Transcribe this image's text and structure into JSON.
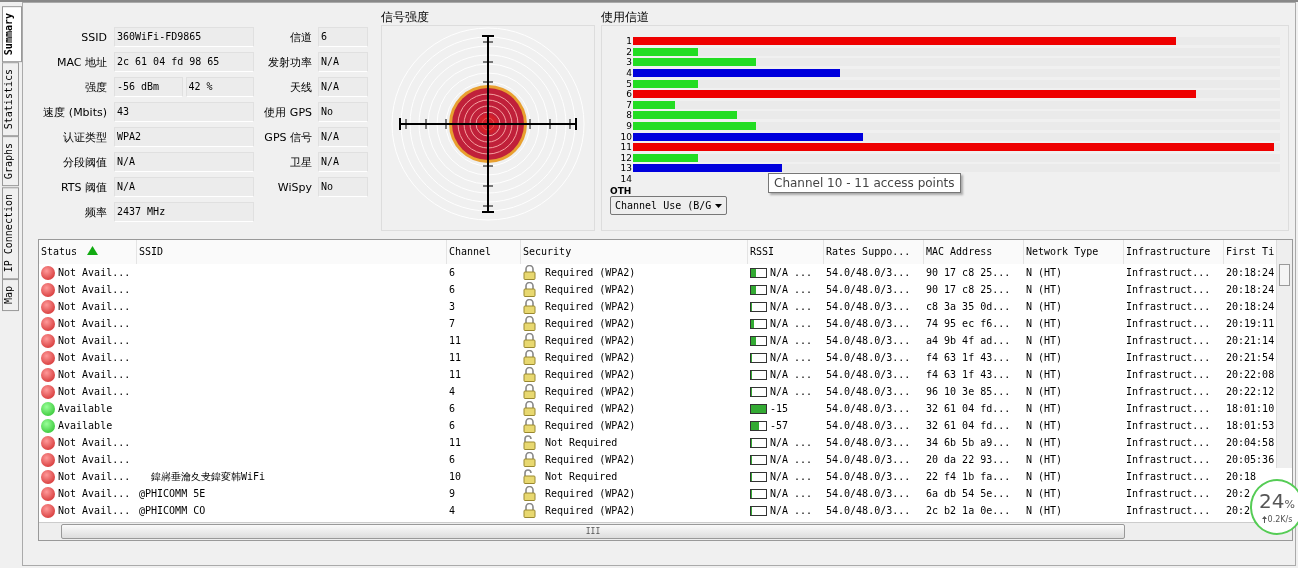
{
  "side_tabs": [
    {
      "label": "Summary",
      "selected": true
    },
    {
      "label": "Statistics",
      "selected": false
    },
    {
      "label": "Graphs",
      "selected": false
    },
    {
      "label": "IP Connection",
      "selected": false
    },
    {
      "label": "Map",
      "selected": false
    }
  ],
  "summary": {
    "left": [
      {
        "label": "SSID",
        "values": [
          "360WiFi-FD9865"
        ]
      },
      {
        "label": "MAC 地址",
        "values": [
          "2c 61 04 fd 98 65"
        ]
      },
      {
        "label": "强度",
        "values": [
          "-56 dBm",
          "42 %"
        ]
      },
      {
        "label": "速度 (Mbits)",
        "values": [
          "43"
        ]
      },
      {
        "label": "认证类型",
        "values": [
          "WPA2"
        ]
      },
      {
        "label": "分段阈值",
        "values": [
          "N/A"
        ]
      },
      {
        "label": "RTS 阈值",
        "values": [
          "N/A"
        ]
      },
      {
        "label": "频率",
        "values": [
          "2437 MHz"
        ]
      }
    ],
    "right": [
      {
        "label": "信道",
        "value": "6"
      },
      {
        "label": "发射功率",
        "value": "N/A"
      },
      {
        "label": "天线",
        "value": "N/A"
      },
      {
        "label": "使用 GPS",
        "value": "No"
      },
      {
        "label": "GPS 信号",
        "value": "N/A"
      },
      {
        "label": "卫星",
        "value": "N/A"
      },
      {
        "label": "WiSpy",
        "value": "No"
      }
    ]
  },
  "signal_panel": {
    "title": "信号强度"
  },
  "channel_panel": {
    "title": "使用信道",
    "channels": [
      {
        "label": "1",
        "level": 0.84,
        "color": "#ee0000"
      },
      {
        "label": "2",
        "level": 0.1,
        "color": "#22dd22"
      },
      {
        "label": "3",
        "level": 0.19,
        "color": "#22dd22"
      },
      {
        "label": "4",
        "level": 0.32,
        "color": "#0000dd"
      },
      {
        "label": "5",
        "level": 0.1,
        "color": "#22dd22"
      },
      {
        "label": "6",
        "level": 0.87,
        "color": "#ee0000"
      },
      {
        "label": "7",
        "level": 0.065,
        "color": "#22dd22"
      },
      {
        "label": "8",
        "level": 0.16,
        "color": "#22dd22"
      },
      {
        "label": "9",
        "level": 0.19,
        "color": "#22dd22"
      },
      {
        "label": "10",
        "level": 0.355,
        "color": "#0000dd"
      },
      {
        "label": "11",
        "level": 0.99,
        "color": "#ee0000"
      },
      {
        "label": "12",
        "level": 0.1,
        "color": "#22dd22"
      },
      {
        "label": "13",
        "level": 0.23,
        "color": "#0000dd"
      },
      {
        "label": "14"
      }
    ],
    "other_label": "OTH",
    "dropdown": "Channel Use (B/G",
    "tooltip": "Channel 10 - 11 access points"
  },
  "table": {
    "columns": [
      "Status",
      "SSID",
      "Channel",
      "Security",
      "RSSI",
      "Rates Suppo...",
      "MAC Address",
      "Network Type",
      "Infrastructure",
      "First Ti"
    ],
    "rows": [
      {
        "available": false,
        "status": "Not Avail...",
        "ssid": "",
        "channel": "6",
        "locked": true,
        "security": "Required (WPA2)",
        "level": 0.35,
        "rssi": "N/A ...",
        "rates": "54.0/48.0/3...",
        "mac": "90 17 c8 25...",
        "type": "N (HT)",
        "infra": "Infrastruct...",
        "first": "20:18:24"
      },
      {
        "available": false,
        "status": "Not Avail...",
        "ssid": "",
        "channel": "6",
        "locked": true,
        "security": "Required (WPA2)",
        "level": 0.35,
        "rssi": "N/A ...",
        "rates": "54.0/48.0/3...",
        "mac": "90 17 c8 25...",
        "type": "N (HT)",
        "infra": "Infrastruct...",
        "first": "20:18:24"
      },
      {
        "available": false,
        "status": "Not Avail...",
        "ssid": "",
        "channel": "3",
        "locked": true,
        "security": "Required (WPA2)",
        "level": 0,
        "rssi": "N/A ...",
        "rates": "54.0/48.0/3...",
        "mac": "c8 3a 35 0d...",
        "type": "N (HT)",
        "infra": "Infrastruct...",
        "first": "20:18:24"
      },
      {
        "available": false,
        "status": "Not Avail...",
        "ssid": "",
        "channel": "7",
        "locked": true,
        "security": "Required (WPA2)",
        "level": 0.2,
        "rssi": "N/A ...",
        "rates": "54.0/48.0/3...",
        "mac": "74 95 ec f6...",
        "type": "N (HT)",
        "infra": "Infrastruct...",
        "first": "20:19:11"
      },
      {
        "available": false,
        "status": "Not Avail...",
        "ssid": "",
        "channel": "11",
        "locked": true,
        "security": "Required (WPA2)",
        "level": 0.35,
        "rssi": "N/A ...",
        "rates": "54.0/48.0/3...",
        "mac": "a4 9b 4f ad...",
        "type": "N (HT)",
        "infra": "Infrastruct...",
        "first": "20:21:14"
      },
      {
        "available": false,
        "status": "Not Avail...",
        "ssid": "",
        "channel": "11",
        "locked": true,
        "security": "Required (WPA2)",
        "level": 0,
        "rssi": "N/A ...",
        "rates": "54.0/48.0/3...",
        "mac": "f4 63 1f 43...",
        "type": "N (HT)",
        "infra": "Infrastruct...",
        "first": "20:21:54"
      },
      {
        "available": false,
        "status": "Not Avail...",
        "ssid": "",
        "channel": "11",
        "locked": true,
        "security": "Required (WPA2)",
        "level": 0,
        "rssi": "N/A ...",
        "rates": "54.0/48.0/3...",
        "mac": "f4 63 1f 43...",
        "type": "N (HT)",
        "infra": "Infrastruct...",
        "first": "20:22:08"
      },
      {
        "available": false,
        "status": "Not Avail...",
        "ssid": "",
        "channel": "4",
        "locked": true,
        "security": "Required (WPA2)",
        "level": 0,
        "rssi": "N/A ...",
        "rates": "54.0/48.0/3...",
        "mac": "96 10 3e 85...",
        "type": "N (HT)",
        "infra": "Infrastruct...",
        "first": "20:22:12"
      },
      {
        "available": true,
        "status": "Available",
        "ssid": "",
        "channel": "6",
        "locked": true,
        "security": "Required (WPA2)",
        "level": 1,
        "rssi": "-15",
        "rates": "54.0/48.0/3...",
        "mac": "32 61 04 fd...",
        "type": "N (HT)",
        "infra": "Infrastruct...",
        "first": "18:01:10"
      },
      {
        "available": true,
        "status": "Available",
        "ssid": "",
        "channel": "6",
        "locked": true,
        "security": "Required (WPA2)",
        "level": 0.5,
        "rssi": "-57",
        "rates": "54.0/48.0/3...",
        "mac": "32 61 04 fd...",
        "type": "N (HT)",
        "infra": "Infrastruct...",
        "first": "18:01:53"
      },
      {
        "available": false,
        "status": "Not Avail...",
        "ssid": "",
        "channel": "11",
        "locked": false,
        "security": "Not Required",
        "level": 0,
        "rssi": "N/A ...",
        "rates": "54.0/48.0/3...",
        "mac": "34 6b 5b a9...",
        "type": "N (HT)",
        "infra": "Infrastruct...",
        "first": "20:04:58"
      },
      {
        "available": false,
        "status": "Not Avail...",
        "ssid": "",
        "channel": "6",
        "locked": true,
        "security": "Required (WPA2)",
        "level": 0,
        "rssi": "N/A ...",
        "rates": "54.0/48.0/3...",
        "mac": "20 da 22 93...",
        "type": "N (HT)",
        "infra": "Infrastruct...",
        "first": "20:05:36"
      },
      {
        "available": false,
        "status": "Not Avail...",
        "ssid": "  鍏嶈垂瀹夊叏鍏変韩WiFi",
        "channel": "10",
        "locked": false,
        "security": "Not Required",
        "level": 0,
        "rssi": "N/A ...",
        "rates": "54.0/48.0/3...",
        "mac": "22 f4 1b fa...",
        "type": "N (HT)",
        "infra": "Infrastruct...",
        "first": "20:18"
      },
      {
        "available": false,
        "status": "Not Avail...",
        "ssid": "@PHICOMM_5E",
        "channel": "9",
        "locked": true,
        "security": "Required (WPA2)",
        "level": 0,
        "rssi": "N/A ...",
        "rates": "54.0/48.0/3...",
        "mac": "6a db 54 5e...",
        "type": "N (HT)",
        "infra": "Infrastruct...",
        "first": "20:2"
      },
      {
        "available": false,
        "status": "Not Avail...",
        "ssid": "@PHICOMM_CO",
        "channel": "4",
        "locked": true,
        "security": "Required (WPA2)",
        "level": 0,
        "rssi": "N/A ...",
        "rates": "54.0/48.0/3...",
        "mac": "2c b2 1a 0e...",
        "type": "N (HT)",
        "infra": "Infrastruct...",
        "first": "20:2"
      }
    ]
  },
  "scroll_grip": "III",
  "speed_widget": {
    "percent": "24",
    "unit": "%",
    "rate": "0.2K/s"
  }
}
